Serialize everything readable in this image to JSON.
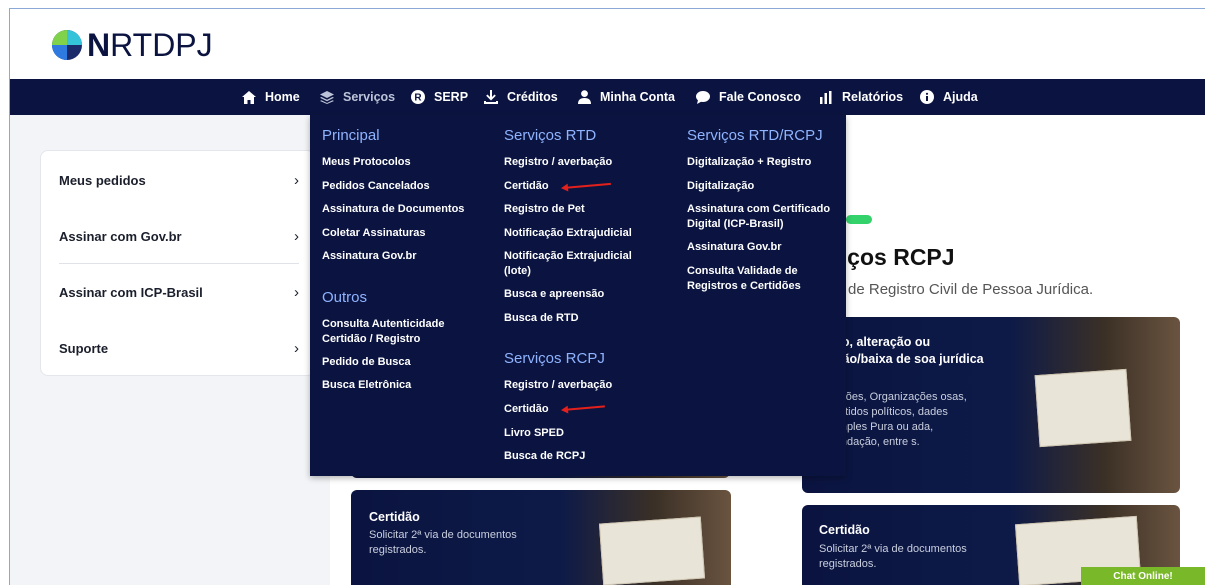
{
  "logo": {
    "bold": "N",
    "rest": "RTDPJ"
  },
  "nav": [
    {
      "label": "Home",
      "icon": "home-icon"
    },
    {
      "label": "Serviços",
      "icon": "layers-icon"
    },
    {
      "label": "SERP",
      "icon": "r-circle-icon"
    },
    {
      "label": "Créditos",
      "icon": "download-icon"
    },
    {
      "label": "Minha Conta",
      "icon": "user-icon"
    },
    {
      "label": "Fale Conosco",
      "icon": "chat-icon"
    },
    {
      "label": "Relatórios",
      "icon": "bar-chart-icon"
    },
    {
      "label": "Ajuda",
      "icon": "info-icon"
    }
  ],
  "sidebar": {
    "items": [
      {
        "label": "Meus pedidos"
      },
      {
        "label": "Assinar com Gov.br"
      },
      {
        "label": "Assinar com ICP-Brasil"
      },
      {
        "label": "Suporte"
      }
    ]
  },
  "menu": {
    "principal": {
      "heading": "Principal",
      "items": [
        "Meus Protocolos",
        "Pedidos Cancelados",
        "Assinatura de Documentos",
        "Coletar Assinaturas",
        "Assinatura Gov.br"
      ]
    },
    "outros": {
      "heading": "Outros",
      "items": [
        "Consulta Autenticidade Certidão / Registro",
        "Pedido de Busca",
        "Busca Eletrônica"
      ]
    },
    "rtd": {
      "heading": "Serviços RTD",
      "items": [
        "Registro / averbação",
        "Certidão",
        "Registro de Pet",
        "Notificação Extrajudicial",
        "Notificação Extrajudicial (lote)",
        "Busca e apreensão",
        "Busca de RTD"
      ]
    },
    "rcpj": {
      "heading": "Serviços RCPJ",
      "items": [
        "Registro / averbação",
        "Certidão",
        "Livro SPED",
        "Busca de RCPJ"
      ]
    },
    "rtdrcpj": {
      "heading": "Serviços RTD/RCPJ",
      "items": [
        "Digitalização + Registro",
        "Digitalização",
        "Assinatura com Certificado Digital (ICP-Brasil)",
        "Assinatura Gov.br",
        "Consulta Validade de Registros e Certidões"
      ]
    }
  },
  "rcpj_section": {
    "title": "viços RCPJ",
    "subtitle": "os de Registro Civil de Pessoa Jurídica."
  },
  "cards": {
    "rcpj_main": {
      "title": "ção, alteração ou nção/baixa de soa jurídica",
      "desc": "dações, Organizações osas, Partidos políticos, dades Simples Pura ou ada, Fundação, entre s."
    },
    "rtd_certidao": {
      "title": "Certidão",
      "desc": "Solicitar 2ª via de documentos registrados."
    },
    "rcpj_certidao": {
      "title": "Certidão",
      "desc": "Solicitar 2ª via de documentos registrados."
    }
  },
  "chat": {
    "label": "Chat Online!"
  },
  "colors": {
    "navy": "#0b1440",
    "menu_heading": "#8fb3ff",
    "accent_green": "#34d26b",
    "arrow_red": "#e3201b",
    "chat_green": "#79b829"
  }
}
